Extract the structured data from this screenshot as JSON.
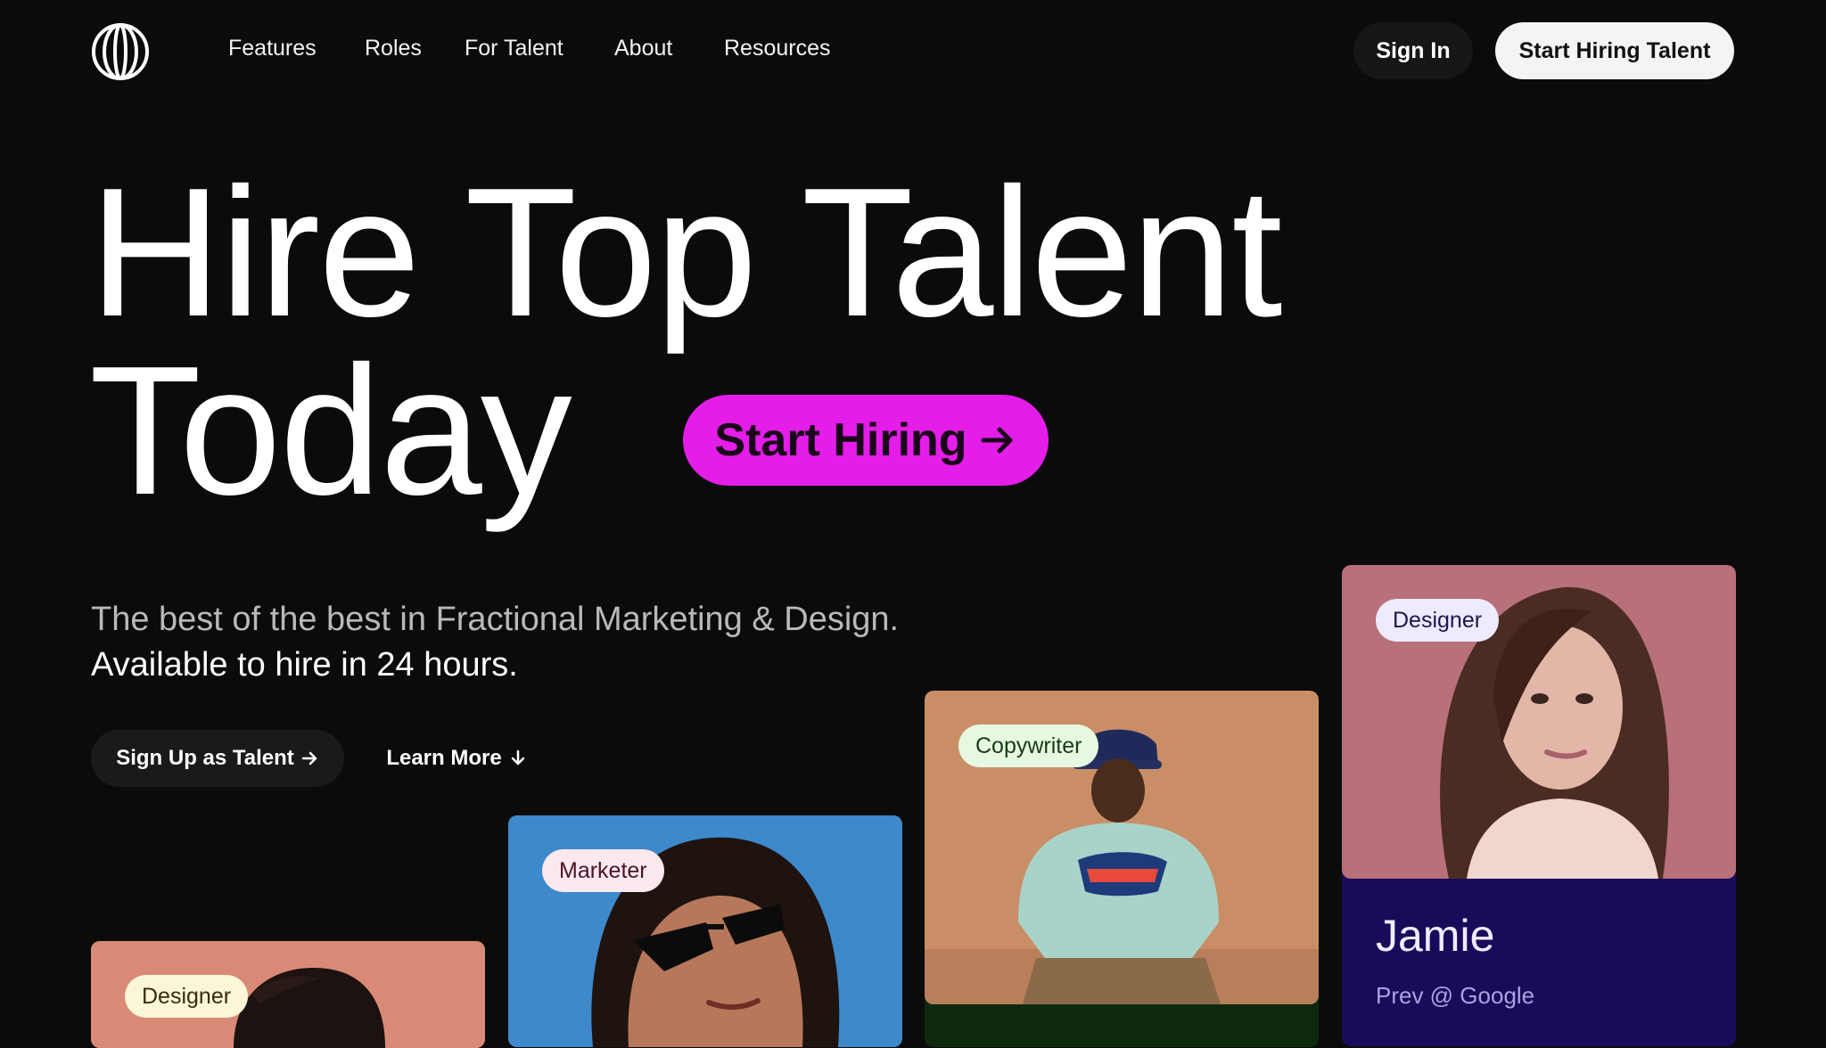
{
  "header": {
    "nav": [
      "Features",
      "Roles",
      "For Talent",
      "About",
      "Resources"
    ],
    "sign_in": "Sign In",
    "start_hiring_talent": "Start Hiring Talent"
  },
  "hero": {
    "line1": "Hire Top Talent",
    "line2": "Today",
    "cta": "Start Hiring",
    "cta_icon": "arrow-right-icon",
    "accent_color": "#e41de9",
    "subtitle_line1": "The best of the best in Fractional Marketing & Design.",
    "subtitle_line2": "Available to hire in 24 hours."
  },
  "actions": {
    "sign_up_talent": "Sign Up as Talent",
    "learn_more": "Learn More"
  },
  "talent_cards": [
    {
      "role": "Designer",
      "tag_bg": "#fbf6d8",
      "tag_color": "#3b2a12"
    },
    {
      "role": "Marketer",
      "tag_bg": "#fbe9ee",
      "tag_color": "#4a1428"
    },
    {
      "role": "Copywriter",
      "tag_bg": "#e6f8e2",
      "tag_color": "#1a3b16"
    },
    {
      "role": "Designer",
      "tag_bg": "#eeeaff",
      "tag_color": "#1d1650",
      "name": "Jamie",
      "prev": "Prev @ Google"
    }
  ]
}
